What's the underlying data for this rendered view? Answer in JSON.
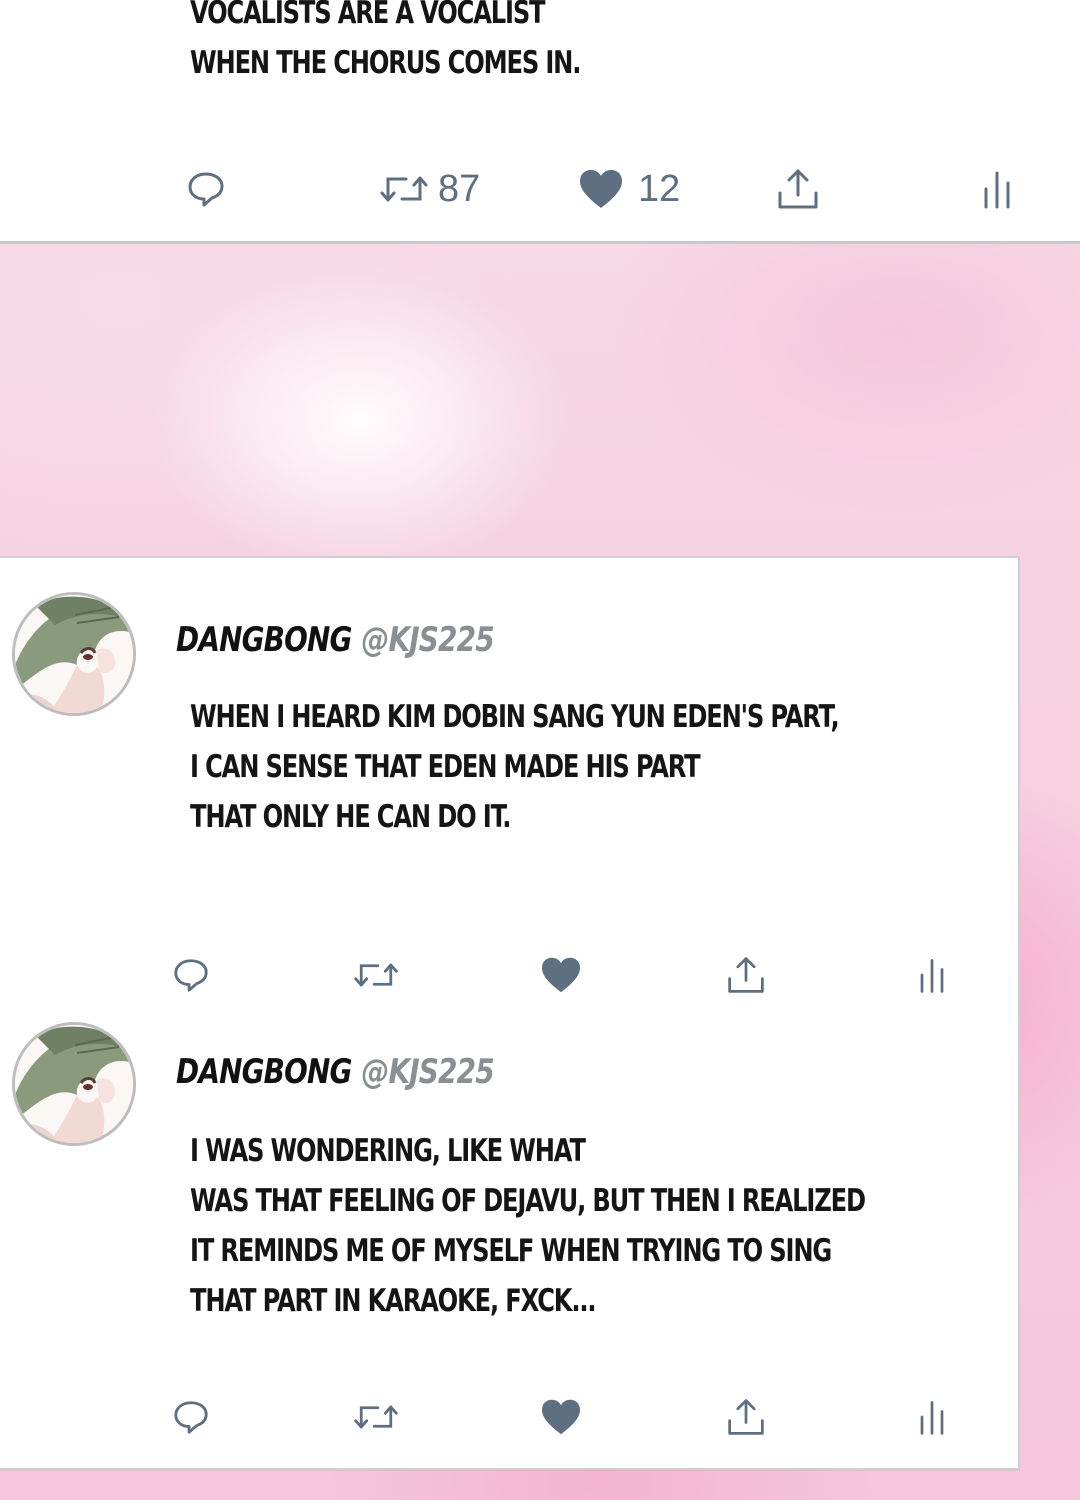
{
  "tweets": [
    {
      "lines": [
        "VOCALISTS ARE A VOCALIST",
        "WHEN THE CHORUS COMES IN."
      ],
      "retweets": "87",
      "likes": "12"
    },
    {
      "author": {
        "name": "DANGBONG",
        "handle": "@KJS225"
      },
      "lines": [
        "WHEN I HEARD KIM DOBIN SANG YUN EDEN'S PART,",
        "I CAN SENSE THAT EDEN MADE HIS PART",
        "THAT ONLY HE CAN DO IT."
      ]
    },
    {
      "author": {
        "name": "DANGBONG",
        "handle": "@KJS225"
      },
      "lines": [
        "I WAS WONDERING, LIKE WHAT",
        "WAS THAT FEELING OF DEJAVU, BUT THEN I REALIZED",
        "IT REMINDS ME OF MYSELF WHEN TRYING TO SING",
        "THAT PART IN KARAOKE, FXCK..."
      ]
    }
  ],
  "icons": {
    "reply": "reply-icon",
    "retweet": "retweet-icon",
    "like": "heart-icon",
    "share": "share-icon",
    "analytics": "analytics-icon"
  },
  "colors": {
    "icon": "#5d6f80",
    "background_pink": "#f5c6dc",
    "text": "#151515",
    "handle": "#8a8f95"
  }
}
